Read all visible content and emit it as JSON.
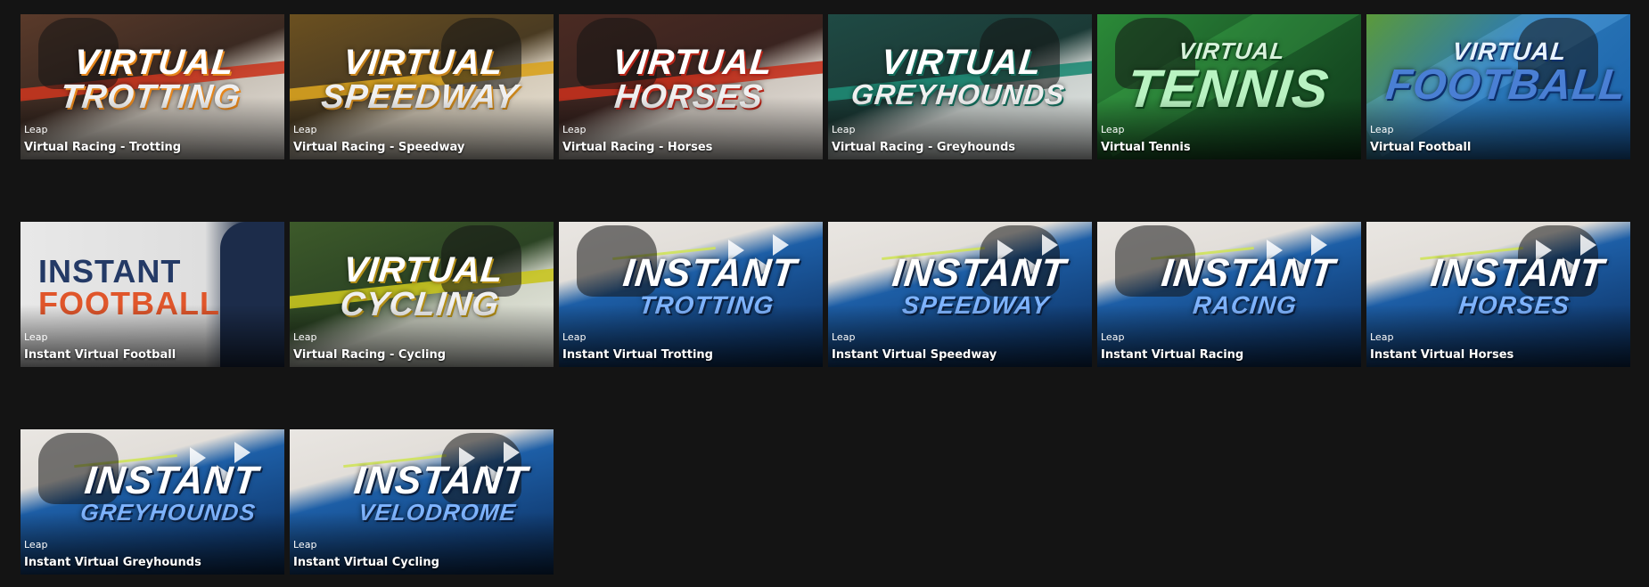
{
  "games": [
    {
      "provider": "Leap",
      "name": "Virtual Racing - Trotting",
      "title1": "VIRTUAL",
      "title2": "TROTTING",
      "bg": "linear-gradient(160deg,#5a3a2a 0%,#3b2a22 45%,#c9c2b8 60%,#e8e3dc 100%)",
      "stripe": "#c8361f",
      "c1": "#ffffff",
      "c2": "#f0f0f0",
      "glow": "#e5861c",
      "style": "virtual",
      "icon": "trotting-horse-figure"
    },
    {
      "provider": "Leap",
      "name": "Virtual Racing - Speedway",
      "title1": "VIRTUAL",
      "title2": "SPEEDWAY",
      "bg": "linear-gradient(160deg,#6b5020 0%,#4a3b22 45%,#d4cab8 60%,#ece6da 100%)",
      "stripe": "#d8a21f",
      "c1": "#ffffff",
      "c2": "#f0f0f0",
      "glow": "#c9851b",
      "style": "virtual",
      "icon": "speedway-rider-figure"
    },
    {
      "provider": "Leap",
      "name": "Virtual Racing - Horses",
      "title1": "VIRTUAL",
      "title2": "HORSES",
      "bg": "linear-gradient(160deg,#4a2a22 0%,#3a2420 45%,#cfc8c0 60%,#ebe6e0 100%)",
      "stripe": "#c4311d",
      "c1": "#ffffff",
      "c2": "#f0f0f0",
      "glow": "#b52418",
      "style": "virtual",
      "icon": "racehorse-figure"
    },
    {
      "provider": "Leap",
      "name": "Virtual Racing - Greyhounds",
      "title1": "VIRTUAL",
      "title2": "GREYHOUNDS",
      "bg": "linear-gradient(160deg,#1f4a44 0%,#1b3a36 45%,#c9cfcc 60%,#e7ebe9 100%)",
      "stripe": "#1f8a74",
      "c1": "#ffffff",
      "c2": "#f0f0f0",
      "glow": "#136b5a",
      "style": "virtual",
      "icon": "greyhound-figure"
    },
    {
      "provider": "Leap",
      "name": "Virtual Tennis",
      "title1": "VIRTUAL",
      "title2": "TENNIS",
      "bg": "linear-gradient(135deg,#2b8a38 0%,#1d5e2a 50%,#0f3a1a 100%)",
      "stripe": "#4ccf5b",
      "c1": "#d9f2dc",
      "c2": "#b9f3c2",
      "glow": "#0e4a1c",
      "style": "tennis",
      "icon": "tennis-player-figure"
    },
    {
      "provider": "Leap",
      "name": "Virtual Football",
      "title1": "VIRTUAL",
      "title2": "FOOTBALL",
      "bg": "linear-gradient(135deg,#5b9a3a 0%,#2a78b8 45%,#1a5fa8 100%)",
      "stripe": "#79c7ff",
      "c1": "#e8f3ff",
      "c2": "#4a7fd4",
      "glow": "#0c2f6b",
      "style": "football",
      "icon": "football-player-figure"
    },
    {
      "provider": "Leap",
      "name": "Instant Virtual Football",
      "title1": "INSTANT",
      "title2": "FOOTBALL",
      "bg": "linear-gradient(90deg,#e8e8e8 0%,#dedede 70%,#27364f 85%,#1b2a44 100%)",
      "stripe": "#e8e8e8",
      "c1": "#243a66",
      "c2": "#e0562b",
      "glow": "transparent",
      "style": "instantfb",
      "icon": "stopwatch-icon"
    },
    {
      "provider": "Leap",
      "name": "Virtual Racing - Cycling",
      "title1": "VIRTUAL",
      "title2": "CYCLING",
      "bg": "linear-gradient(160deg,#3d5a2a 0%,#2c4424 45%,#d0d4c6 60%,#eceee6 100%)",
      "stripe": "#c8c41f",
      "c1": "#ffffff",
      "c2": "#f0f0f0",
      "glow": "#b59018",
      "style": "virtual",
      "icon": "cyclist-figure"
    },
    {
      "provider": "Leap",
      "name": "Instant Virtual Trotting",
      "title1": "INSTANT",
      "title2": "TROTTING",
      "bg": "linear-gradient(165deg,#e9e6e2 0%,#e2ded9 28%,#1d5ea6 40%,#123f77 75%,#0b2a52 100%)",
      "stripe": "#cfe35a",
      "c1": "#ffffff",
      "c2": "#7fb4ff",
      "glow": "#0a1f3f",
      "style": "instant",
      "icon": "trotting-horse-figure"
    },
    {
      "provider": "Leap",
      "name": "Instant Virtual Speedway",
      "title1": "INSTANT",
      "title2": "SPEEDWAY",
      "bg": "linear-gradient(165deg,#e9e6e2 0%,#e2ded9 28%,#1d5ea6 40%,#123f77 75%,#0b2a52 100%)",
      "stripe": "#cfe35a",
      "c1": "#ffffff",
      "c2": "#7fb4ff",
      "glow": "#0a1f3f",
      "style": "instant",
      "icon": "speedway-rider-figure"
    },
    {
      "provider": "Leap",
      "name": "Instant Virtual Racing",
      "title1": "INSTANT",
      "title2": "RACING",
      "bg": "linear-gradient(165deg,#e9e6e2 0%,#e2ded9 28%,#1d5ea6 40%,#123f77 75%,#0b2a52 100%)",
      "stripe": "#cfe35a",
      "c1": "#ffffff",
      "c2": "#7fb4ff",
      "glow": "#0a1f3f",
      "style": "instant",
      "icon": "racehorse-figure"
    },
    {
      "provider": "Leap",
      "name": "Instant Virtual Horses",
      "title1": "INSTANT",
      "title2": "HORSES",
      "bg": "linear-gradient(165deg,#e9e6e2 0%,#e2ded9 28%,#1d5ea6 40%,#123f77 75%,#0b2a52 100%)",
      "stripe": "#cfe35a",
      "c1": "#ffffff",
      "c2": "#7fb4ff",
      "glow": "#0a1f3f",
      "style": "instant",
      "icon": "racehorse-figure"
    },
    {
      "provider": "Leap",
      "name": "Instant Virtual Greyhounds",
      "title1": "INSTANT",
      "title2": "GREYHOUNDS",
      "bg": "linear-gradient(165deg,#e9e6e2 0%,#e2ded9 28%,#1d5ea6 40%,#123f77 75%,#0b2a52 100%)",
      "stripe": "#cfe35a",
      "c1": "#ffffff",
      "c2": "#7fb4ff",
      "glow": "#0a1f3f",
      "style": "instant",
      "icon": "greyhound-figure"
    },
    {
      "provider": "Leap",
      "name": "Instant Virtual Cycling",
      "title1": "INSTANT",
      "title2": "VELODROME",
      "bg": "linear-gradient(165deg,#e9e6e2 0%,#e2ded9 28%,#1d5ea6 40%,#123f77 75%,#0b2a52 100%)",
      "stripe": "#cfe35a",
      "c1": "#ffffff",
      "c2": "#7fb4ff",
      "glow": "#0a1f3f",
      "style": "instant",
      "icon": "cyclist-figure"
    }
  ]
}
